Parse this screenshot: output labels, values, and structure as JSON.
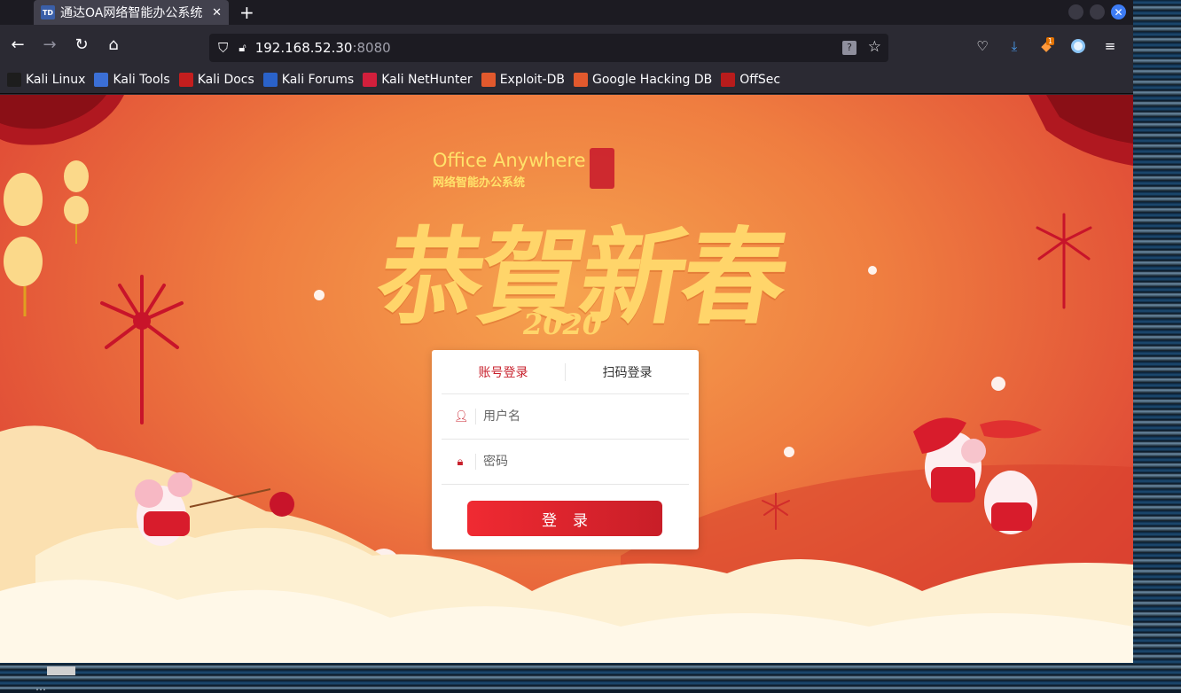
{
  "tab": {
    "favicon": "TD",
    "title": "通达OA网络智能办公系统",
    "close_icon": "close-icon"
  },
  "url": {
    "host": "192.168.52.30",
    "port": ":8080"
  },
  "bookmarks": [
    {
      "label": "Kali Linux",
      "icon": "kali-dragon-icon",
      "color": "#1d1d1d"
    },
    {
      "label": "Kali Tools",
      "icon": "kali-tools-icon",
      "color": "#3b6fd6"
    },
    {
      "label": "Kali Docs",
      "icon": "kali-docs-icon",
      "color": "#c41e1e"
    },
    {
      "label": "Kali Forums",
      "icon": "kali-forums-icon",
      "color": "#2a62c9"
    },
    {
      "label": "Kali NetHunter",
      "icon": "kali-nethunter-icon",
      "color": "#d21f3c"
    },
    {
      "label": "Exploit-DB",
      "icon": "exploit-db-icon",
      "color": "#e2592d"
    },
    {
      "label": "Google Hacking DB",
      "icon": "ghdb-icon",
      "color": "#e2592d"
    },
    {
      "label": "OffSec",
      "icon": "offsec-icon",
      "color": "#b81c1c"
    }
  ],
  "brand": {
    "en": "Office Anywhere",
    "cn": "网络智能办公系统"
  },
  "greeting": {
    "text": "恭賀新春",
    "year": "2020"
  },
  "login": {
    "tabs": [
      "账号登录",
      "扫码登录"
    ],
    "username_placeholder": "用户名",
    "password_placeholder": "密码",
    "submit_label": "登录"
  },
  "colors": {
    "accent": "#c8202c",
    "button_start": "#f02a32",
    "button_end": "#c81e28",
    "brand_text": "#ffe26a"
  },
  "taskbar": {
    "text": "…"
  }
}
